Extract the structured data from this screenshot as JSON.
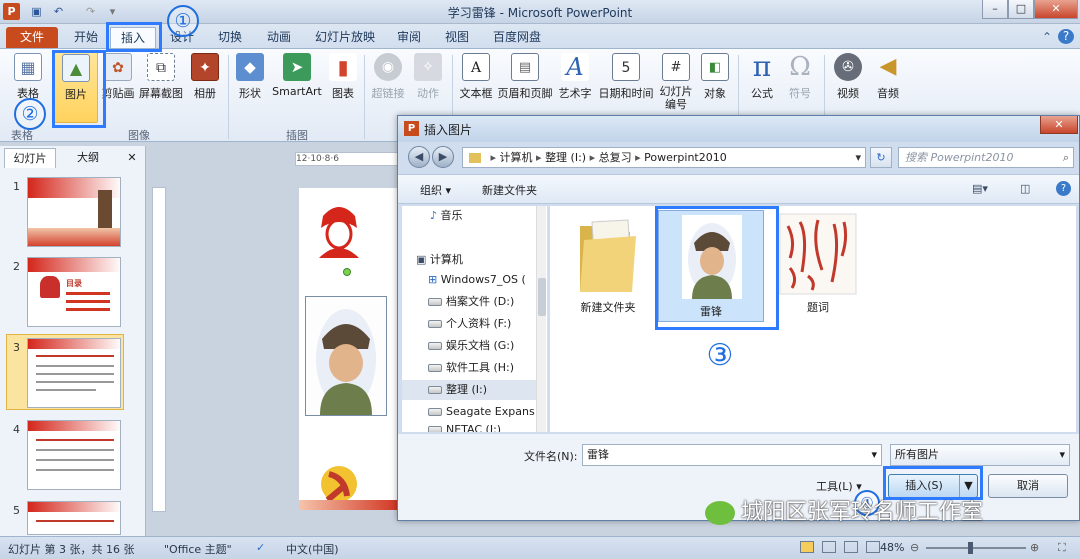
{
  "window": {
    "title": "学习雷锋 - Microsoft PowerPoint"
  },
  "ribbon_tabs": [
    "文件",
    "开始",
    "插入",
    "设计",
    "切换",
    "动画",
    "幻灯片放映",
    "审阅",
    "视图",
    "百度网盘"
  ],
  "ribbon": {
    "buttons": {
      "table": "表格",
      "picture": "图片",
      "clipart": "剪贴画",
      "screenshot": "屏幕截图",
      "album": "相册",
      "shapes": "形状",
      "smartart": "SmartArt",
      "chart": "图表",
      "hyperlink": "超链接",
      "action": "动作",
      "textbox": "文本框",
      "header_footer": "页眉和页脚",
      "wordart": "艺术字",
      "datetime": "日期和时间",
      "slide_number": "幻灯片\n编号",
      "object": "对象",
      "equation": "公式",
      "symbol": "符号",
      "video": "视频",
      "audio": "音频"
    },
    "groups": {
      "tables": "表格",
      "images": "图像",
      "illustrations": "插图"
    }
  },
  "annotations": [
    "①",
    "②",
    "③",
    "④"
  ],
  "slide_pane": {
    "tabs": [
      "幻灯片",
      "大纲"
    ],
    "close": "✕",
    "thumbs": [
      {
        "num": "1"
      },
      {
        "num": "2",
        "title": "目录"
      },
      {
        "num": "3"
      },
      {
        "num": "4"
      },
      {
        "num": "5"
      }
    ]
  },
  "ruler_top": "12·10·8·6",
  "dialog": {
    "title": "插入图片",
    "breadcrumb": [
      "计算机",
      "整理 (I:)",
      "总复习",
      "Powerpint2010"
    ],
    "search_placeholder": "搜索 Powerpint2010",
    "toolbar": {
      "organize": "组织 ▾",
      "new_folder": "新建文件夹"
    },
    "nav_items": [
      "音乐",
      "计算机",
      "Windows7_OS (",
      "档案文件 (D:)",
      "个人资料 (F:)",
      "娱乐文档 (G:)",
      "软件工具 (H:)",
      "整理 (I:)",
      "Seagate Expans",
      "NETAC (J:)"
    ],
    "files": [
      {
        "name": "新建文件夹"
      },
      {
        "name": "雷锋"
      },
      {
        "name": "题词"
      }
    ],
    "filename_label": "文件名(N):",
    "filename_value": "雷锋",
    "filetype_value": "所有图片",
    "tools_label": "工具(L)",
    "insert_label": "插入(S)",
    "cancel_label": "取消"
  },
  "statusbar": {
    "slide_info": "幻灯片 第 3 张，共 16 张",
    "theme": "\"Office 主题\"",
    "language": "中文(中国)",
    "zoom": "48%"
  },
  "watermark": "城阳区张军玲名师工作室",
  "colors": {
    "accent_blue": "#2f7bff",
    "file_tab": "#c84b1e",
    "selection": "#cce4fb"
  }
}
